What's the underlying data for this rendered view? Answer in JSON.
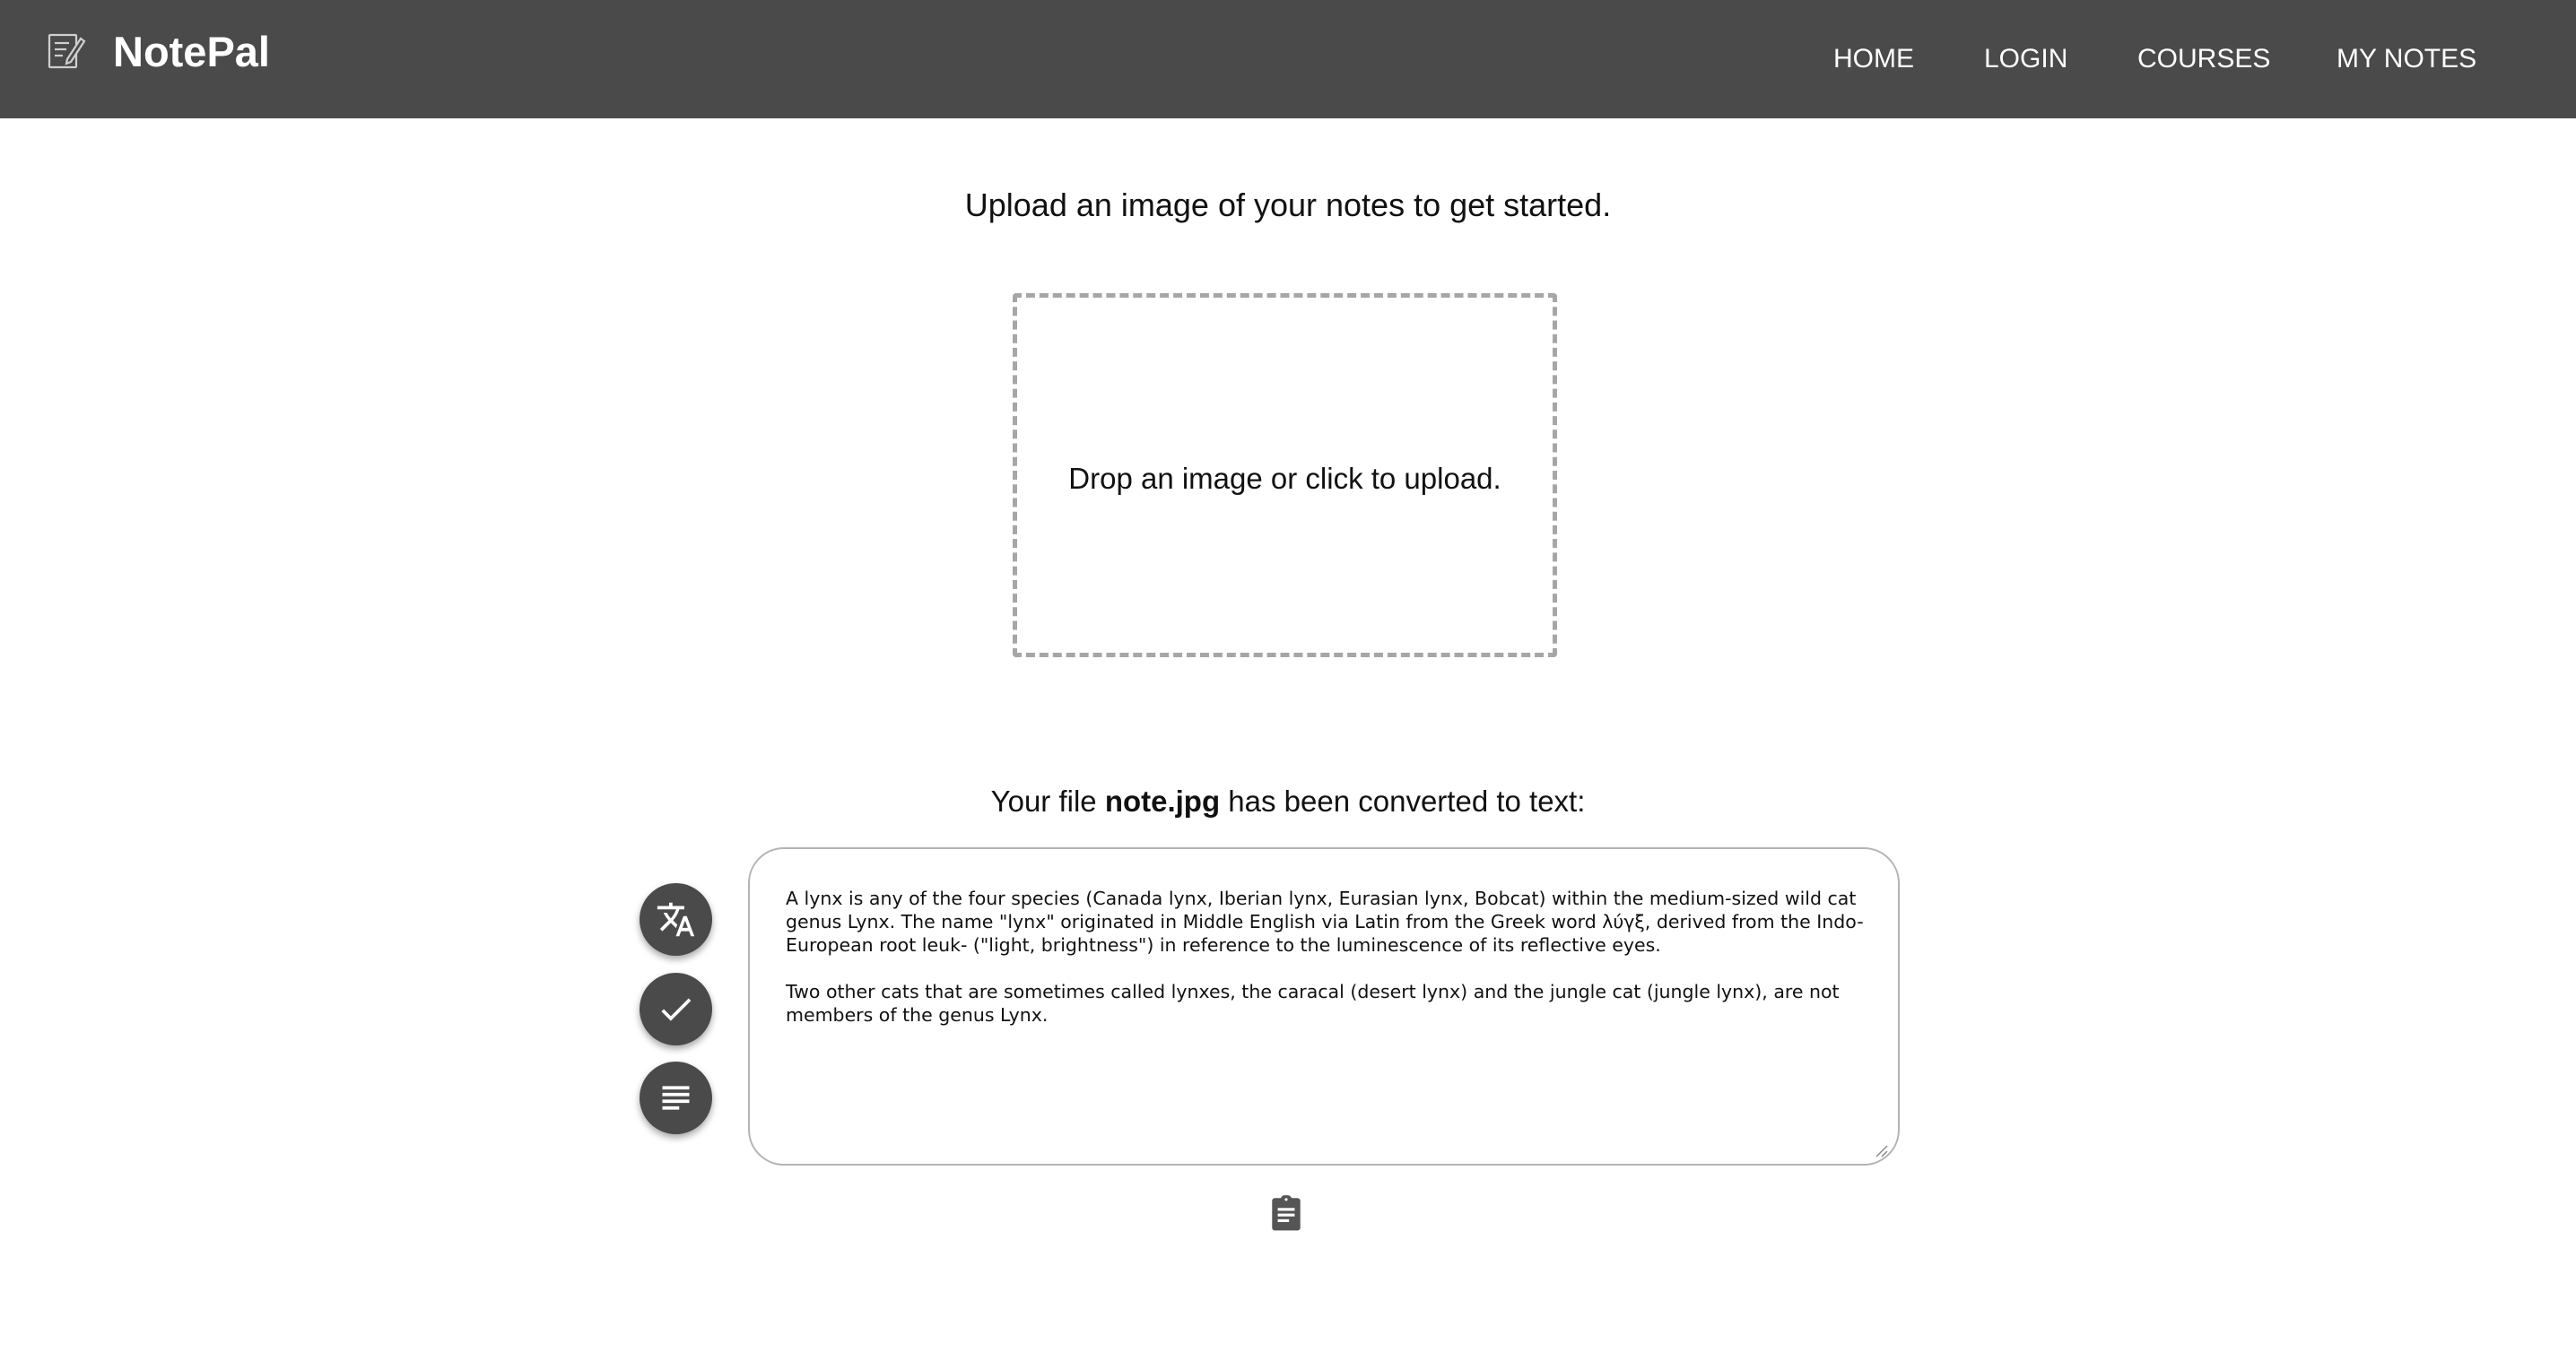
{
  "header": {
    "logo_icon": "note-edit-icon",
    "brand": "NotePal",
    "background_color": "#4a4a4a",
    "nav": [
      {
        "label": "HOME"
      },
      {
        "label": "LOGIN"
      },
      {
        "label": "COURSES"
      },
      {
        "label": "MY NOTES"
      }
    ]
  },
  "main": {
    "upload_heading": "Upload an image of your notes to get started.",
    "dropzone_text": "Drop an image or click to upload.",
    "converted_prefix": "Your file ",
    "converted_filename": "note.jpg",
    "converted_suffix": " has been converted to text:",
    "converted_text": {
      "paragraph_1": "A lynx is any of the four species (Canada lynx, Iberian lynx, Eurasian lynx, Bobcat) within the medium-sized wild cat genus Lynx. The name \"lynx\" originated in Middle English via Latin from the Greek word λύγξ, derived from the Indo-European root leuk- (\"light, brightness\") in reference to the luminescence of its reflective eyes.",
      "paragraph_2": "Two other cats that are sometimes called lynxes, the caracal (desert lynx) and the jungle cat (jungle lynx), are not members of the genus Lynx."
    },
    "action_buttons": [
      {
        "icon": "translate-icon"
      },
      {
        "icon": "check-icon"
      },
      {
        "icon": "summary-icon"
      }
    ],
    "copy_icon": "clipboard-icon"
  }
}
